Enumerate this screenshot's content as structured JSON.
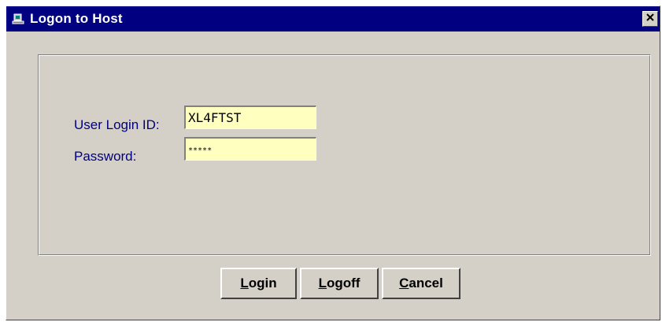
{
  "window": {
    "title": "Logon to Host",
    "app_icon": "logon-app-icon",
    "close_icon": "close-icon"
  },
  "form": {
    "user_login_label": "User Login ID:",
    "user_login_value": "XL4FTST",
    "password_label": "Password:",
    "password_value": "*****"
  },
  "buttons": {
    "login": {
      "accel": "L",
      "rest": "ogin"
    },
    "logoff": {
      "accel": "L",
      "rest": "ogoff"
    },
    "cancel": {
      "accel": "C",
      "rest": "ancel"
    }
  },
  "colors": {
    "titlebar": "#000080",
    "label_text": "#000080",
    "field_background": "#ffffc0",
    "dialog_face": "#d4d0c8"
  }
}
